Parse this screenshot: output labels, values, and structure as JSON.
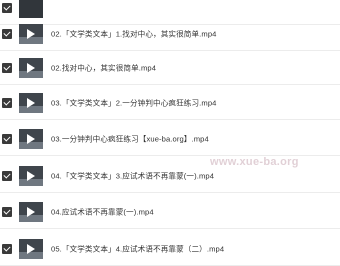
{
  "files": [
    {
      "name": "02.「文学类文本」1.找对中心，其实很简单.mp4",
      "selected": true
    },
    {
      "name": "02.找对中心，其实很简单.mp4",
      "selected": true
    },
    {
      "name": "03.「文学类文本」2.一分钟判中心疯狂练习.mp4",
      "selected": true
    },
    {
      "name": "03.一分钟判中心疯狂练习【xue-ba.org】.mp4",
      "selected": true
    },
    {
      "name": "04.「文学类文本」3.应试术语不再靠蒙(一).mp4",
      "selected": true
    },
    {
      "name": "04.应试术语不再靠蒙(一).mp4",
      "selected": true
    },
    {
      "name": "05.「文学类文本」4.应试术语不再靠蒙（二）.mp4",
      "selected": true
    }
  ],
  "watermark": "www.xue-ba.org",
  "icons": {
    "checkbox": "checkbox-checked-icon",
    "thumbnail": "video-thumbnail-icon",
    "play": "play-icon"
  }
}
